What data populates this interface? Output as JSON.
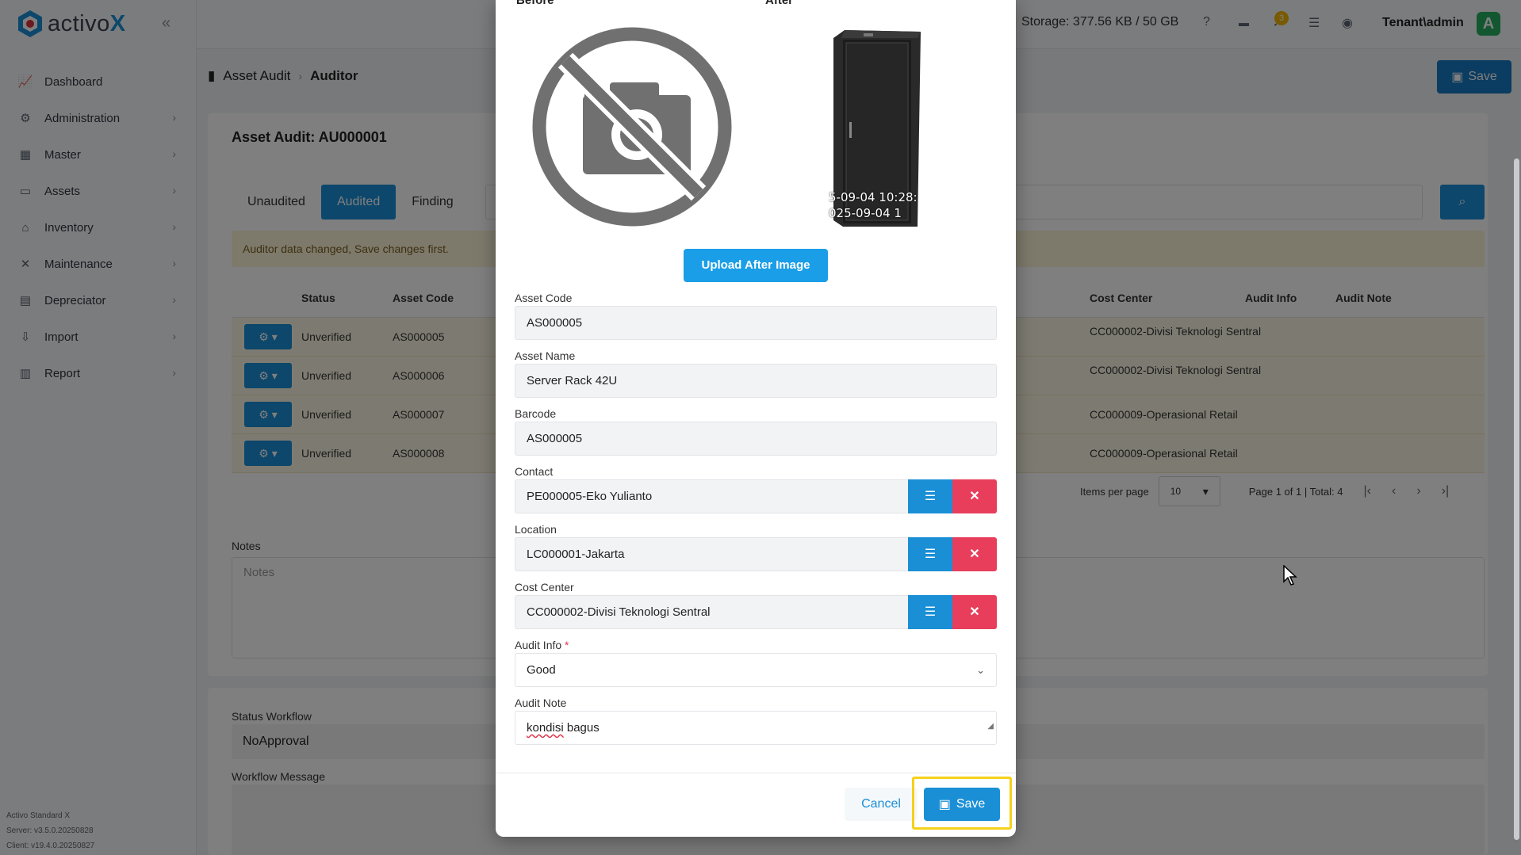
{
  "app": {
    "brand_prefix": "activo",
    "brand_suffix": "X"
  },
  "sidebar": {
    "items": [
      {
        "label": "Dashboard",
        "icon": "chart-icon",
        "has_children": false
      },
      {
        "label": "Administration",
        "icon": "gears-icon",
        "has_children": true
      },
      {
        "label": "Master",
        "icon": "database-icon",
        "has_children": true
      },
      {
        "label": "Assets",
        "icon": "laptop-icon",
        "has_children": true
      },
      {
        "label": "Inventory",
        "icon": "warehouse-icon",
        "has_children": true
      },
      {
        "label": "Maintenance",
        "icon": "tools-icon",
        "has_children": true
      },
      {
        "label": "Depreciator",
        "icon": "calculator-icon",
        "has_children": true
      },
      {
        "label": "Import",
        "icon": "import-icon",
        "has_children": true
      },
      {
        "label": "Report",
        "icon": "report-chart-icon",
        "has_children": true
      }
    ],
    "footer": {
      "product": "Activo Standard X",
      "server": "Server: v3.5.0.20250828",
      "client": "Client: v19.4.0.20250827"
    }
  },
  "topbar": {
    "storage": "Storage: 377.56 KB / 50 GB",
    "notification_count": "3",
    "user": "Tenant\\admin",
    "avatar_letter": "A"
  },
  "breadcrumb": {
    "parent": "Asset Audit",
    "current": "Auditor"
  },
  "page": {
    "save_label": "Save",
    "title": "Asset Audit: AU000001",
    "tabs": [
      "Unaudited",
      "Audited",
      "Finding"
    ],
    "active_tab": "Audited",
    "warning": "Auditor data changed, Save changes first.",
    "columns": [
      "Status",
      "Asset Code",
      "Cost Center",
      "Audit Info",
      "Audit Note"
    ],
    "rows": [
      {
        "status": "Unverified",
        "asset_code": "AS000005",
        "cost_center": "CC000002-Divisi Teknologi Sentral"
      },
      {
        "status": "Unverified",
        "asset_code": "AS000006",
        "cost_center": "CC000002-Divisi Teknologi Sentral"
      },
      {
        "status": "Unverified",
        "asset_code": "AS000007",
        "cost_center": "CC000009-Operasional Retail"
      },
      {
        "status": "Unverified",
        "asset_code": "AS000008",
        "cost_center": "CC000009-Operasional Retail"
      }
    ],
    "pager": {
      "items_per_page_label": "Items per page",
      "items_per_page": "10",
      "summary": "Page 1 of 1 | Total: 4"
    },
    "notes_label": "Notes",
    "notes_placeholder": "Notes",
    "status_workflow_label": "Status Workflow",
    "status_workflow": "NoApproval",
    "workflow_message_label": "Workflow Message"
  },
  "modal": {
    "before_label": "Before",
    "after_label": "After",
    "after_timestamp_1": "5-09-04 10:28:",
    "after_timestamp_2": "025-09-04 1",
    "upload_label": "Upload After Image",
    "asset_code_label": "Asset Code",
    "asset_code": "AS000005",
    "asset_name_label": "Asset Name",
    "asset_name": "Server Rack 42U",
    "barcode_label": "Barcode",
    "barcode": "AS000005",
    "contact_label": "Contact",
    "contact": "PE000005-Eko Yulianto",
    "location_label": "Location",
    "location": "LC000001-Jakarta",
    "cost_center_label": "Cost Center",
    "cost_center": "CC000002-Divisi Teknologi Sentral",
    "audit_info_label": "Audit Info",
    "audit_info_required": "*",
    "audit_info": "Good",
    "audit_note_label": "Audit Note",
    "audit_note_word1": "kondisi",
    "audit_note_word2": " bagus",
    "cancel_label": "Cancel",
    "save_label": "Save"
  },
  "colors": {
    "primary": "#1a8fd6",
    "danger": "#e83e5c",
    "highlight": "#f5d11a",
    "warning_bg": "#fbf3d6"
  }
}
